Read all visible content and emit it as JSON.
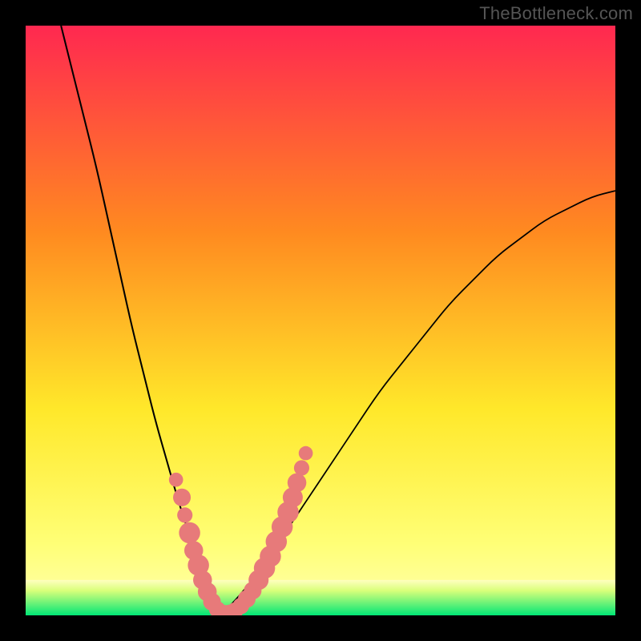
{
  "watermark": "TheBottleneck.com",
  "chart_data": {
    "type": "line",
    "title": "",
    "xlabel": "",
    "ylabel": "",
    "xlim": [
      0,
      100
    ],
    "ylim": [
      0,
      100
    ],
    "grid": false,
    "legend": false,
    "background_gradient": {
      "top": "#ff2850",
      "mid1": "#ff8a20",
      "mid2": "#ffe82a",
      "bottom_band_top": "#ffff77",
      "bottom_band_bottom": "#00e676"
    },
    "green_band": {
      "y_from": 0,
      "y_to": 6
    },
    "minimum_x": 33,
    "series": [
      {
        "name": "left-branch",
        "annotation": "black curve, descends steeply from top-left into valley",
        "x": [
          6,
          8,
          10,
          12,
          14,
          16,
          18,
          20,
          22,
          24,
          26,
          28,
          30,
          32,
          33
        ],
        "y": [
          100,
          92,
          84,
          76,
          67,
          58,
          49,
          41,
          33,
          26,
          19,
          13,
          8,
          3,
          0
        ]
      },
      {
        "name": "right-branch",
        "annotation": "black curve, rises from valley toward upper-right, shallower than left branch",
        "x": [
          33,
          36,
          40,
          44,
          48,
          52,
          56,
          60,
          64,
          68,
          72,
          76,
          80,
          84,
          88,
          92,
          96,
          100
        ],
        "y": [
          0,
          3,
          8,
          14,
          20,
          26,
          32,
          38,
          43,
          48,
          53,
          57,
          61,
          64,
          67,
          69,
          71,
          72
        ]
      }
    ],
    "blobs": {
      "name": "salmon-dots",
      "annotation": "clustered rounded markers along lower part of both branches near the valley",
      "color": "#e77a7a",
      "points": [
        {
          "x": 25.5,
          "y": 23,
          "r": 1.2
        },
        {
          "x": 26.5,
          "y": 20,
          "r": 1.5
        },
        {
          "x": 27,
          "y": 17,
          "r": 1.3
        },
        {
          "x": 27.8,
          "y": 14,
          "r": 1.8
        },
        {
          "x": 28.5,
          "y": 11,
          "r": 1.6
        },
        {
          "x": 29.3,
          "y": 8.5,
          "r": 1.8
        },
        {
          "x": 30,
          "y": 6,
          "r": 1.6
        },
        {
          "x": 30.8,
          "y": 4,
          "r": 1.6
        },
        {
          "x": 31.6,
          "y": 2.3,
          "r": 1.5
        },
        {
          "x": 32.5,
          "y": 1.0,
          "r": 1.4
        },
        {
          "x": 33.5,
          "y": 0.4,
          "r": 1.4
        },
        {
          "x": 34.5,
          "y": 0.4,
          "r": 1.4
        },
        {
          "x": 35.5,
          "y": 0.8,
          "r": 1.4
        },
        {
          "x": 36.5,
          "y": 1.6,
          "r": 1.4
        },
        {
          "x": 37.5,
          "y": 2.8,
          "r": 1.5
        },
        {
          "x": 38.5,
          "y": 4.2,
          "r": 1.5
        },
        {
          "x": 39.5,
          "y": 6,
          "r": 1.7
        },
        {
          "x": 40.5,
          "y": 8,
          "r": 1.8
        },
        {
          "x": 41.5,
          "y": 10,
          "r": 1.8
        },
        {
          "x": 42.5,
          "y": 12.5,
          "r": 1.8
        },
        {
          "x": 43.5,
          "y": 15,
          "r": 1.8
        },
        {
          "x": 44.5,
          "y": 17.5,
          "r": 1.8
        },
        {
          "x": 45.3,
          "y": 20,
          "r": 1.7
        },
        {
          "x": 46.0,
          "y": 22.5,
          "r": 1.6
        },
        {
          "x": 46.8,
          "y": 25,
          "r": 1.3
        },
        {
          "x": 47.5,
          "y": 27.5,
          "r": 1.2
        }
      ]
    }
  }
}
